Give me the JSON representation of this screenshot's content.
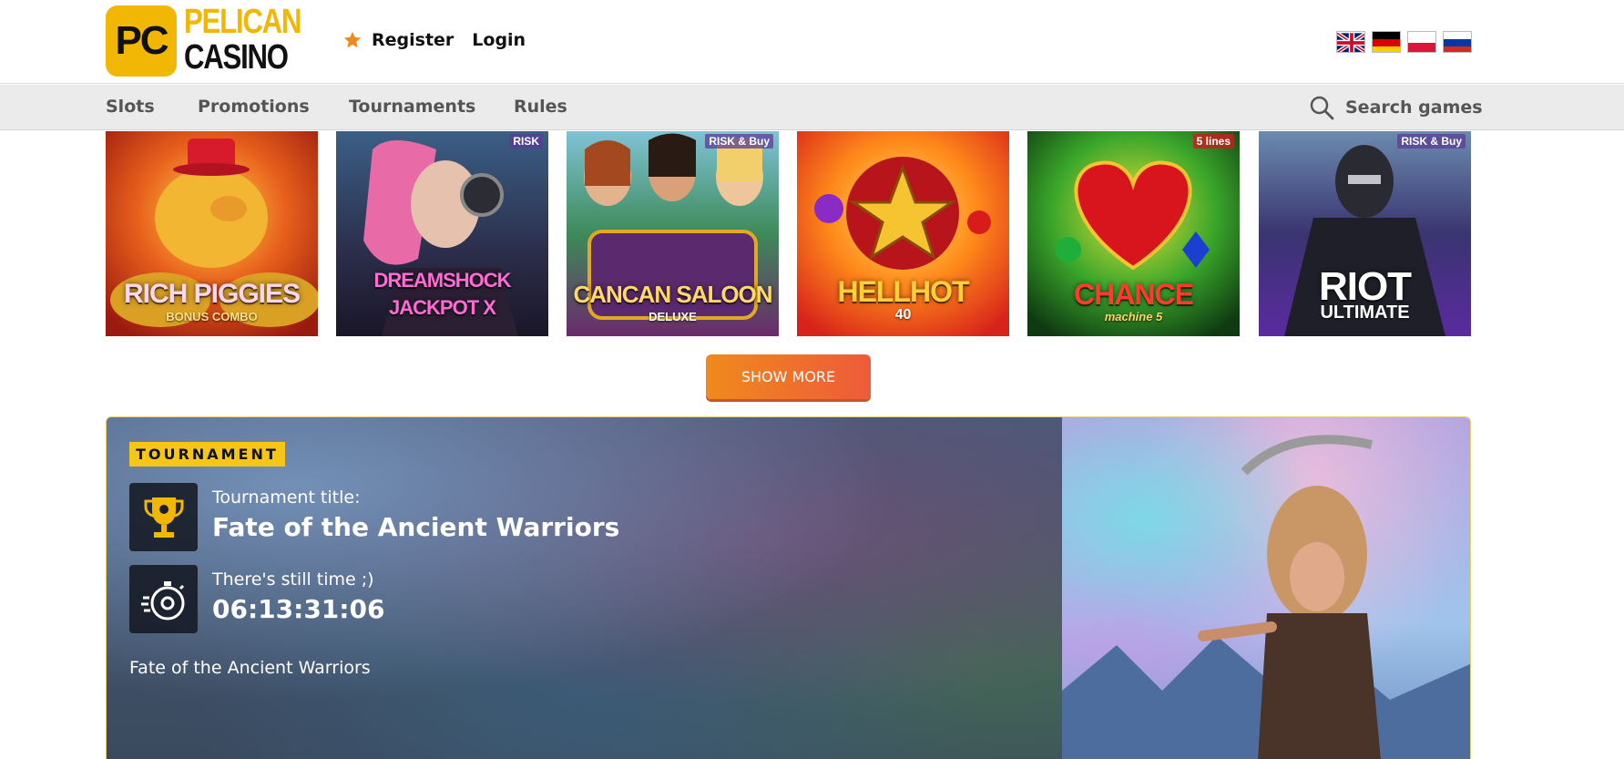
{
  "logo": {
    "badge": "PC",
    "line1": "PELICAN",
    "line2": "CASINO"
  },
  "auth": {
    "register": "Register",
    "login": "Login"
  },
  "flags": [
    "uk-flag-icon",
    "german-flag-icon",
    "polish-flag-icon",
    "russian-flag-icon"
  ],
  "nav": {
    "items": [
      "Slots",
      "Promotions",
      "Tournaments",
      "Rules"
    ],
    "search_label": "Search games"
  },
  "games": [
    {
      "title": "RICH PIGGIES",
      "subtitle": "BONUS COMBO",
      "badge": ""
    },
    {
      "title": "DREAMSHOCK JACKPOT X",
      "subtitle": "",
      "badge": "RISK"
    },
    {
      "title": "CANCAN SALOON",
      "subtitle": "DELUXE",
      "badge": "RISK & Buy"
    },
    {
      "title": "HELLHOT",
      "subtitle": "40",
      "badge": ""
    },
    {
      "title": "CHANCE",
      "subtitle": "machine 5",
      "badge": "5 lines"
    },
    {
      "title": "RIOT",
      "subtitle": "ULTIMATE",
      "badge": "RISK & Buy"
    }
  ],
  "show_more": "SHOW MORE",
  "tournament": {
    "tag": "TOURNAMENT",
    "title_label": "Tournament title:",
    "title": "Fate of the Ancient Warriors",
    "time_label": "There's still time ;)",
    "timer": "06:13:31:06",
    "description": "Fate of the Ancient Warriors"
  },
  "colors": {
    "brand_yellow": "#f2b705",
    "button_orange": "#f08a1c",
    "tag_yellow": "#f5c518"
  }
}
